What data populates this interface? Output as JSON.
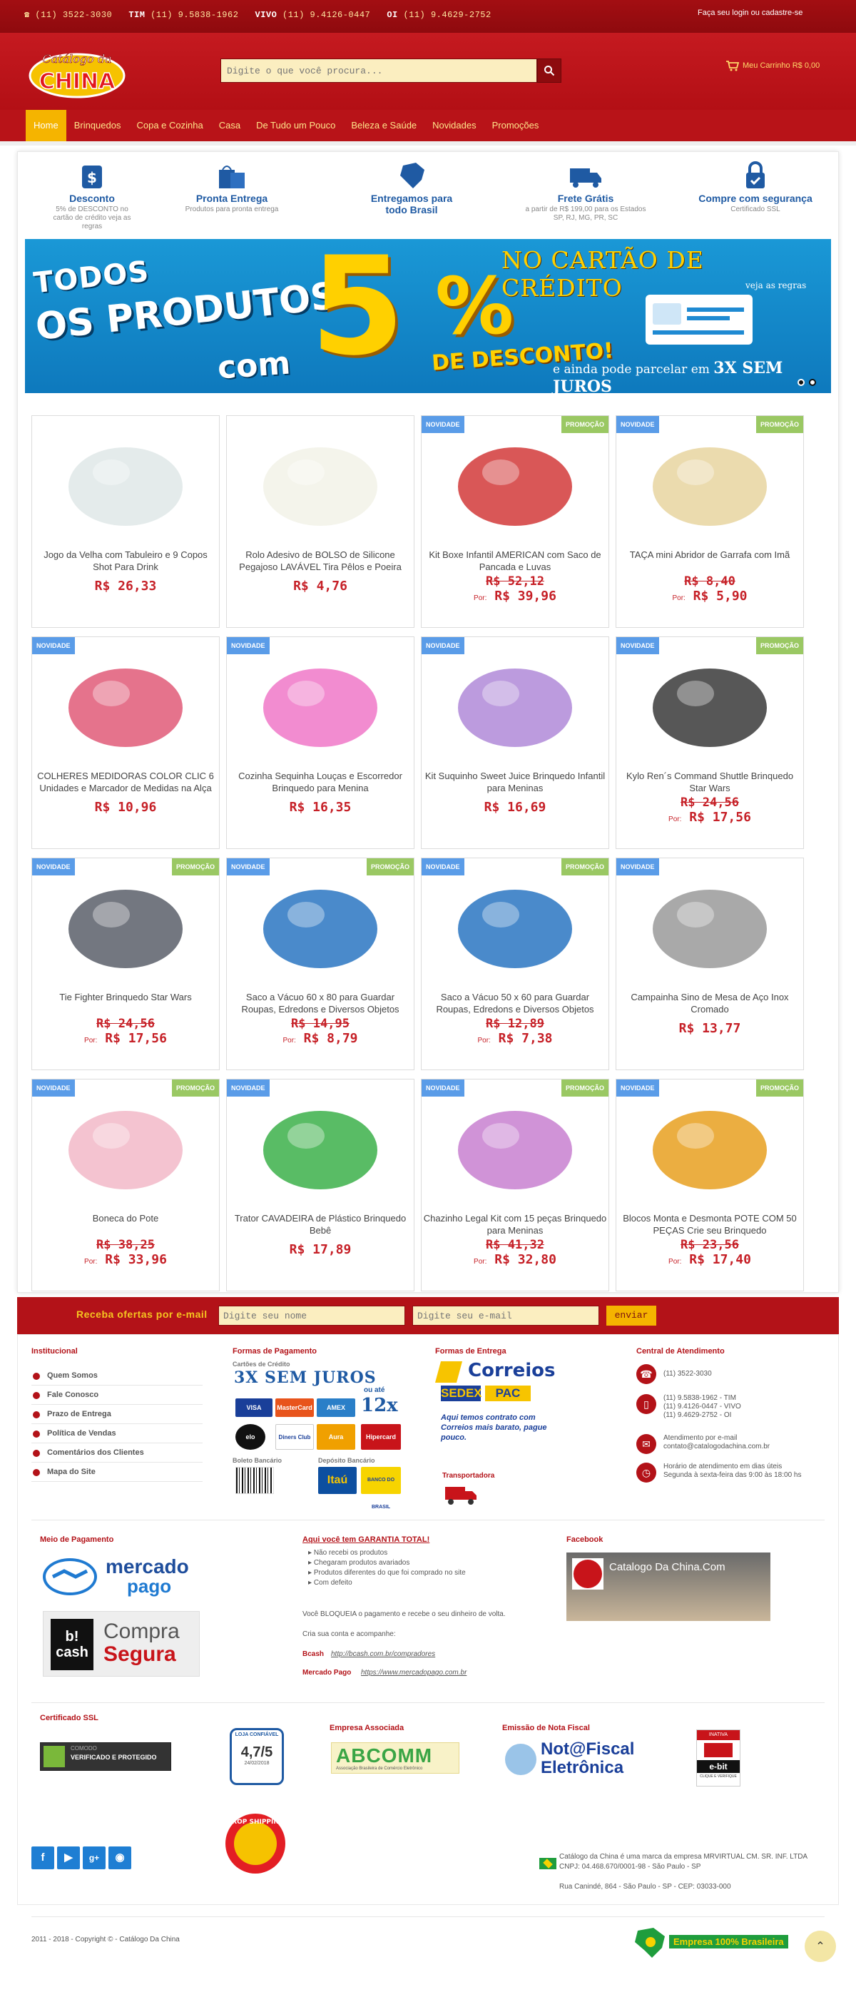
{
  "topbar": {
    "phone1_prefix": "☎ (11)",
    "phone1": "3522-3030",
    "tim_label": "TIM",
    "tim": "(11) 9.5838-1962",
    "vivo_label": "VIVO",
    "vivo": "(11) 9.4126-0447",
    "oi_label": "OI",
    "oi": "(11) 9.4629-2752",
    "login": "Faça seu login ou cadastre-se"
  },
  "header": {
    "logo_text_1": "Catálogo da",
    "logo_text_2": "CHINA",
    "search_placeholder": "Digite o que você procura...",
    "cart": "Meu Carrinho R$ 0,00"
  },
  "nav": {
    "items": [
      "Home",
      "Brinquedos",
      "Copa e Cozinha",
      "Casa",
      "De Tudo um Pouco",
      "Beleza e Saúde",
      "Novidades",
      "Promoções"
    ]
  },
  "features": [
    {
      "title": "Desconto",
      "sub": "5% de DESCONTO no cartão de crédito veja as regras",
      "icon": "dollar-bag-icon"
    },
    {
      "title": "Pronta Entrega",
      "sub": "Produtos para pronta entrega",
      "icon": "shopping-bag-icon"
    },
    {
      "title": "Entregamos para todo Brasil",
      "sub": "",
      "icon": "brazil-map-icon"
    },
    {
      "title": "Frete Grátis",
      "sub": "a partir de R$ 199,00 para os Estados SP, RJ, MG, PR, SC",
      "icon": "truck-icon"
    },
    {
      "title": "Compre com segurança",
      "sub": "Certificado SSL",
      "icon": "lock-icon"
    }
  ],
  "banner": {
    "line1": "TODOS",
    "line2": "OS PRODUTOS",
    "line3": "com",
    "big": "5",
    "pct": "%",
    "desc": "DE DESCONTO!",
    "cc": "NO CARTÃO DE CRÉDITO",
    "rules": "veja as regras",
    "parc_prefix": "e ainda pode parcelar em",
    "parc_bold": "3X SEM JUROS"
  },
  "products": [
    {
      "name": "Jogo da Velha com Tabuleiro e 9 Copos Shot Para Drink",
      "price": "R$ 26,33",
      "old": "",
      "novidade": false,
      "promocao": false,
      "icon": "shot-glasses-icon"
    },
    {
      "name": "Rolo Adesivo de BOLSO de Silicone Pegajoso LAVÁVEL Tira Pêlos e Poeira",
      "price": "R$ 4,76",
      "old": "",
      "novidade": false,
      "promocao": false,
      "icon": "lint-roller-icon"
    },
    {
      "name": "Kit Boxe Infantil AMERICAN com Saco de Pancada e Luvas",
      "price": "R$ 39,96",
      "old": "R$ 52,12",
      "novidade": true,
      "promocao": true,
      "icon": "boxing-bag-icon"
    },
    {
      "name": "TAÇA mini Abridor de Garrafa com Imã",
      "price": "R$ 5,90",
      "old": "R$ 8,40",
      "novidade": true,
      "promocao": true,
      "icon": "bottle-opener-icon"
    },
    {
      "name": "COLHERES MEDIDORAS COLOR CLIC 6 Unidades e Marcador de Medidas na Alça",
      "price": "R$ 10,96",
      "old": "",
      "novidade": true,
      "promocao": false,
      "icon": "measuring-cups-icon"
    },
    {
      "name": "Cozinha Sequinha Louças e Escorredor Brinquedo para Menina",
      "price": "R$ 16,35",
      "old": "",
      "novidade": true,
      "promocao": false,
      "icon": "dish-rack-toy-icon"
    },
    {
      "name": "Kit Suquinho Sweet Juice Brinquedo Infantil para Meninas",
      "price": "R$ 16,69",
      "old": "",
      "novidade": true,
      "promocao": false,
      "icon": "juice-kit-icon"
    },
    {
      "name": "Kylo Ren´s Command Shuttle Brinquedo Star Wars",
      "price": "R$ 17,56",
      "old": "R$ 24,56",
      "novidade": true,
      "promocao": true,
      "icon": "shuttle-toy-icon"
    },
    {
      "name": "Tie Fighter Brinquedo Star Wars",
      "price": "R$ 17,56",
      "old": "R$ 24,56",
      "novidade": true,
      "promocao": true,
      "icon": "tie-fighter-icon"
    },
    {
      "name": "Saco a Vácuo 60 x 80 para Guardar Roupas, Edredons e Diversos Objetos",
      "price": "R$ 8,79",
      "old": "R$ 14,95",
      "novidade": true,
      "promocao": true,
      "icon": "vacuum-bag-icon"
    },
    {
      "name": "Saco a Vácuo 50 x 60 para Guardar Roupas, Edredons e Diversos Objetos",
      "price": "R$ 7,38",
      "old": "R$ 12,89",
      "novidade": true,
      "promocao": true,
      "icon": "vacuum-bag-icon"
    },
    {
      "name": "Campainha Sino de Mesa de Aço Inox Cromado",
      "price": "R$ 13,77",
      "old": "",
      "novidade": true,
      "promocao": false,
      "icon": "desk-bell-icon"
    },
    {
      "name": "Boneca do Pote",
      "price": "R$ 33,96",
      "old": "R$ 38,25",
      "novidade": true,
      "promocao": true,
      "icon": "doll-jar-icon"
    },
    {
      "name": "Trator CAVADEIRA de Plástico Brinquedo Bebê",
      "price": "R$ 17,89",
      "old": "",
      "novidade": true,
      "promocao": false,
      "icon": "toy-tractor-icon"
    },
    {
      "name": "Chazinho Legal Kit com 15 peças Brinquedo para Meninas",
      "price": "R$ 32,80",
      "old": "R$ 41,32",
      "novidade": true,
      "promocao": true,
      "icon": "tea-set-icon"
    },
    {
      "name": "Blocos Monta e Desmonta POTE COM 50 PEÇAS Crie seu Brinquedo",
      "price": "R$ 17,40",
      "old": "R$ 23,56",
      "novidade": true,
      "promocao": true,
      "icon": "blocks-icon"
    }
  ],
  "labels": {
    "novidade": "NOVIDADE",
    "promocao": "PROMOÇÃO",
    "por": "Por:"
  },
  "newsletter": {
    "label": "Receba ofertas por e-mail",
    "name_placeholder": "Digite seu nome",
    "email_placeholder": "Digite seu e-mail",
    "button": "enviar"
  },
  "footer": {
    "institucional_title": "Institucional",
    "institucional": [
      "Quem Somos",
      "Fale Conosco",
      "Prazo de Entrega",
      "Política de Vendas",
      "Comentários dos Clientes",
      "Mapa do Site"
    ],
    "pagamento_title": "Formas de Pagamento",
    "cartoes_label": "Cartões de Crédito",
    "sem_juros": "3X SEM JUROS",
    "ou_ate": "ou até",
    "twelve": "12x",
    "cards": [
      "VISA",
      "MasterCard",
      "AMEX",
      "elo",
      "Diners Club",
      "Aura",
      "Hipercard"
    ],
    "boleto_label": "Boleto Bancário",
    "deposito_label": "Depósito Bancário",
    "banks": [
      "Itaú",
      "BANCO DO BRASIL"
    ],
    "entrega_title": "Formas de Entrega",
    "correios": "Correios",
    "sedex": "SEDEX",
    "pac": "PAC",
    "correios_note": "Aqui temos contrato com Correios mais barato, pague pouco.",
    "transportadora": "Transportadora",
    "atendimento_title": "Central de Atendimento",
    "phone": "(11) 3522-3030",
    "mobiles": [
      "(11) 9.5838-1962 - TIM",
      "(11) 9.4126-0447 - VIVO",
      "(11) 9.4629-2752 - OI"
    ],
    "email_label": "Atendimento por e-mail",
    "email": "contato@catalogodachina.com.br",
    "hours_label": "Horário de atendimento em dias úteis",
    "hours": "Segunda à sexta-feira das 9:00 às 18:00 hs",
    "meio_title": "Meio de Pagamento",
    "mercado": "mercado",
    "pago": "pago",
    "compra": "Compra",
    "segura": "Segura",
    "bcash": "b! cash",
    "garantia_title": "Aqui você tem GARANTIA TOTAL!",
    "garantia_items": [
      "Não recebi os produtos",
      "Chegaram produtos avariados",
      "Produtos diferentes do que foi comprado no site",
      "Com defeito"
    ],
    "garantia_text": "Você BLOQUEIA o pagamento e recebe o seu dinheiro de volta.",
    "cria_conta": "Cria sua conta e acompanhe:",
    "bcash_label": "Bcash",
    "bcash_url": "http://bcash.com.br/compradores",
    "mp_label": "Mercado Pago",
    "mp_url": "https://www.mercadopago.com.br",
    "facebook_title": "Facebook",
    "facebook_page": "Catalogo Da China.Com",
    "ssl_title": "Certificado SSL",
    "ssl_text": "VERIFICADO E PROTEGIDO",
    "ssl_brand": "COMODO",
    "loja_confiavel": "LOJA CONFIÁVEL",
    "rating": "4,7/5",
    "rating_date": "24/02/2018",
    "empresa_title": "Empresa Associada",
    "abcomm": "ABCOMM",
    "abcomm_sub": "Associação Brasileira de Comércio Eletrônico",
    "nota_title": "Emissão de Nota Fiscal",
    "nota_1": "Not@Fiscal",
    "nota_2": "Eletrônica",
    "ebit": "e-bit",
    "ebit_top": "INATIVA",
    "ebit_bottom": "CLIQUE E VERIFIQUE",
    "drop": "DROP SHIPPING",
    "company": "Catálogo da China é uma marca da empresa MRVIRTUAL CM. SR. INF. LTDA",
    "cnpj": "CNPJ: 04.468.670/0001-98 - São Paulo - SP",
    "address": "Rua Canindé, 864 - São Paulo - SP - CEP: 03033-000",
    "copyright": "2011 - 2018 - Copyright © - Catálogo Da China",
    "empresa_brasileira": "Empresa 100% Brasileira"
  },
  "colors": {
    "brand_red": "#b31218",
    "accent_yellow": "#f5b400",
    "blue_title": "#1f5aa3",
    "novidade": "#5a9ce8",
    "promocao": "#9ac863",
    "price": "#c62027"
  }
}
